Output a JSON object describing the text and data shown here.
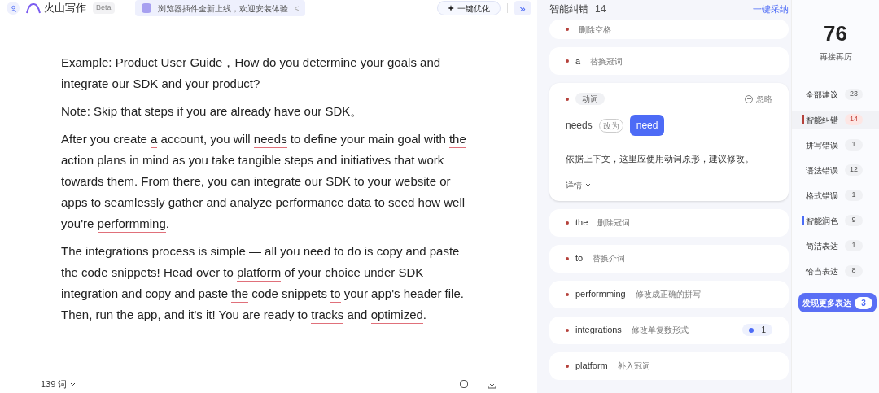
{
  "header": {
    "app_name": "火山写作",
    "badge": "Beta",
    "banner": "浏览器插件全新上线，欢迎安装体验",
    "banner_close": "<",
    "optimize_button": "一键优化",
    "collapse_button": "»"
  },
  "editor": {
    "paragraphs": [
      [
        {
          "text": "Example: Product User Guide，How do you determine your goals and integrate our SDK and your product?",
          "flagged": false
        }
      ],
      [
        {
          "text": "Note: Skip ",
          "flagged": false
        },
        {
          "text": "that",
          "flagged": true
        },
        {
          "text": " steps if you ",
          "flagged": false
        },
        {
          "text": " are",
          "flagged": true
        },
        {
          "text": " already have our SDK。",
          "flagged": false
        }
      ],
      [
        {
          "text": "After you create ",
          "flagged": false
        },
        {
          "text": "a",
          "flagged": true
        },
        {
          "text": " account, you will ",
          "flagged": false
        },
        {
          "text": "needs",
          "flagged": true
        },
        {
          "text": " to define your main goal with ",
          "flagged": false
        },
        {
          "text": "the",
          "flagged": true
        },
        {
          "text": " action plans in mind as you take tangible steps and initiatives that work towards them. From there, you can integrate our SDK ",
          "flagged": false
        },
        {
          "text": "to",
          "flagged": true
        },
        {
          "text": " your website or apps to seamlessly gather and analyze performance data to seed how well you're ",
          "flagged": false
        },
        {
          "text": "performming",
          "flagged": true
        },
        {
          "text": ".",
          "flagged": false
        }
      ],
      [
        {
          "text": "The ",
          "flagged": false
        },
        {
          "text": "integrations",
          "flagged": true
        },
        {
          "text": " process is simple — all you need to do is copy and paste the code snippets! Head over to ",
          "flagged": false
        },
        {
          "text": "platform",
          "flagged": true
        },
        {
          "text": " of your choice under SDK integration and copy and paste ",
          "flagged": false
        },
        {
          "text": "the",
          "flagged": true
        },
        {
          "text": " code snippets ",
          "flagged": false
        },
        {
          "text": "to",
          "flagged": true
        },
        {
          "text": " your app's header file. Then, run the app, and it's it! You are ready to ",
          "flagged": false
        },
        {
          "text": "tracks",
          "flagged": true
        },
        {
          "text": " and ",
          "flagged": false
        },
        {
          "text": "optimized",
          "flagged": true
        },
        {
          "text": ".",
          "flagged": false
        }
      ]
    ],
    "word_count": "139 词"
  },
  "panel": {
    "title": "智能纠错",
    "count": "14",
    "accept_all": "一键采纳",
    "cards": [
      {
        "kind": "collapsed",
        "note": "删除空格"
      },
      {
        "kind": "collapsed",
        "word": "a",
        "note": "替换冠词"
      },
      {
        "kind": "expanded",
        "tag": "动词",
        "ignore": "忽略",
        "from": "needs",
        "change_label": "改为",
        "to": "need",
        "explanation": "依据上下文，这里应使用动词原形，建议修改。",
        "details": "详情"
      },
      {
        "kind": "collapsed",
        "word": "the",
        "note": "删除冠词"
      },
      {
        "kind": "collapsed",
        "word": "to",
        "note": "替换介词"
      },
      {
        "kind": "collapsed",
        "word": "performming",
        "note": "修改成正确的拼写"
      },
      {
        "kind": "collapsed",
        "word": "integrations",
        "note": "修改单复数形式",
        "extra": "+1"
      },
      {
        "kind": "collapsed",
        "word": "platform",
        "note": "补入冠词"
      }
    ]
  },
  "sidebar": {
    "score": "76",
    "score_label": "再接再厉",
    "items": [
      {
        "label": "全部建议",
        "count": "23",
        "selected": false
      },
      {
        "label": "智能纠错",
        "count": "14",
        "selected": true,
        "color": "#b5413b"
      },
      {
        "label": "拼写错误",
        "count": "1",
        "selected": false
      },
      {
        "label": "语法错误",
        "count": "12",
        "selected": false
      },
      {
        "label": "格式错误",
        "count": "1",
        "selected": false
      },
      {
        "label": "智能润色",
        "count": "9",
        "selected": false,
        "color": "#4a6cf7"
      },
      {
        "label": "简洁表达",
        "count": "1",
        "selected": false
      },
      {
        "label": "恰当表达",
        "count": "8",
        "selected": false
      }
    ],
    "more_button": "发现更多表达",
    "more_count": "3"
  }
}
